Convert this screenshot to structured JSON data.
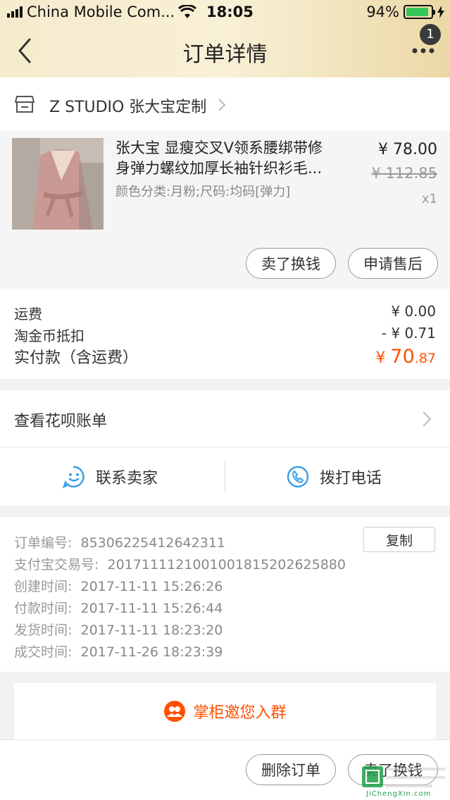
{
  "status_bar": {
    "carrier": "China Mobile Com...",
    "time": "18:05",
    "battery": "94%"
  },
  "header": {
    "title": "订单详情",
    "badge": "1"
  },
  "shop": {
    "name": "Z STUDIO 张大宝定制"
  },
  "product": {
    "name_line1": "张大宝 显瘦交叉V领系腰绑带修",
    "name_line2": "身弹力螺纹加厚长袖针织衫毛...",
    "spec": "颜色分类:月粉;尺码:均码[弹力]",
    "price": "¥ 78.00",
    "original_price": "¥ 112.85",
    "quantity": "x1",
    "actions": [
      "卖了换钱",
      "申请售后"
    ]
  },
  "fees": {
    "shipping_label": "运费",
    "shipping_value": "¥ 0.00",
    "coin_label": "淘金币抵扣",
    "coin_value": "- ¥ 0.71",
    "paid_label": "实付款（含运费）",
    "paid_currency": "¥ ",
    "paid_int": "70",
    "paid_dec": ".87"
  },
  "huabei": {
    "label": "查看花呗账单"
  },
  "contact": {
    "seller": "联系卖家",
    "phone": "拨打电话"
  },
  "order_info": {
    "copy_label": "复制",
    "rows": [
      {
        "label": "订单编号:",
        "value": "85306225412642311"
      },
      {
        "label": "支付宝交易号:",
        "value": "2017111121001001815202625880"
      },
      {
        "label": "创建时间:",
        "value": "2017-11-11 15:26:26"
      },
      {
        "label": "付款时间:",
        "value": "2017-11-11 15:26:44"
      },
      {
        "label": "发货时间:",
        "value": "2017-11-11 18:23:20"
      },
      {
        "label": "成交时间:",
        "value": "2017-11-26 18:23:39"
      }
    ]
  },
  "group_banner": {
    "label": "掌柜邀您入群"
  },
  "bottom_bar": {
    "delete_label": "删除订单",
    "sell_label": "卖了换钱"
  },
  "watermark": {
    "text": "JiChengXin.com"
  },
  "colors": {
    "accent": "#ff5000",
    "header_gold": "#ecd8a6",
    "contact_blue": "#3aa0e8"
  }
}
